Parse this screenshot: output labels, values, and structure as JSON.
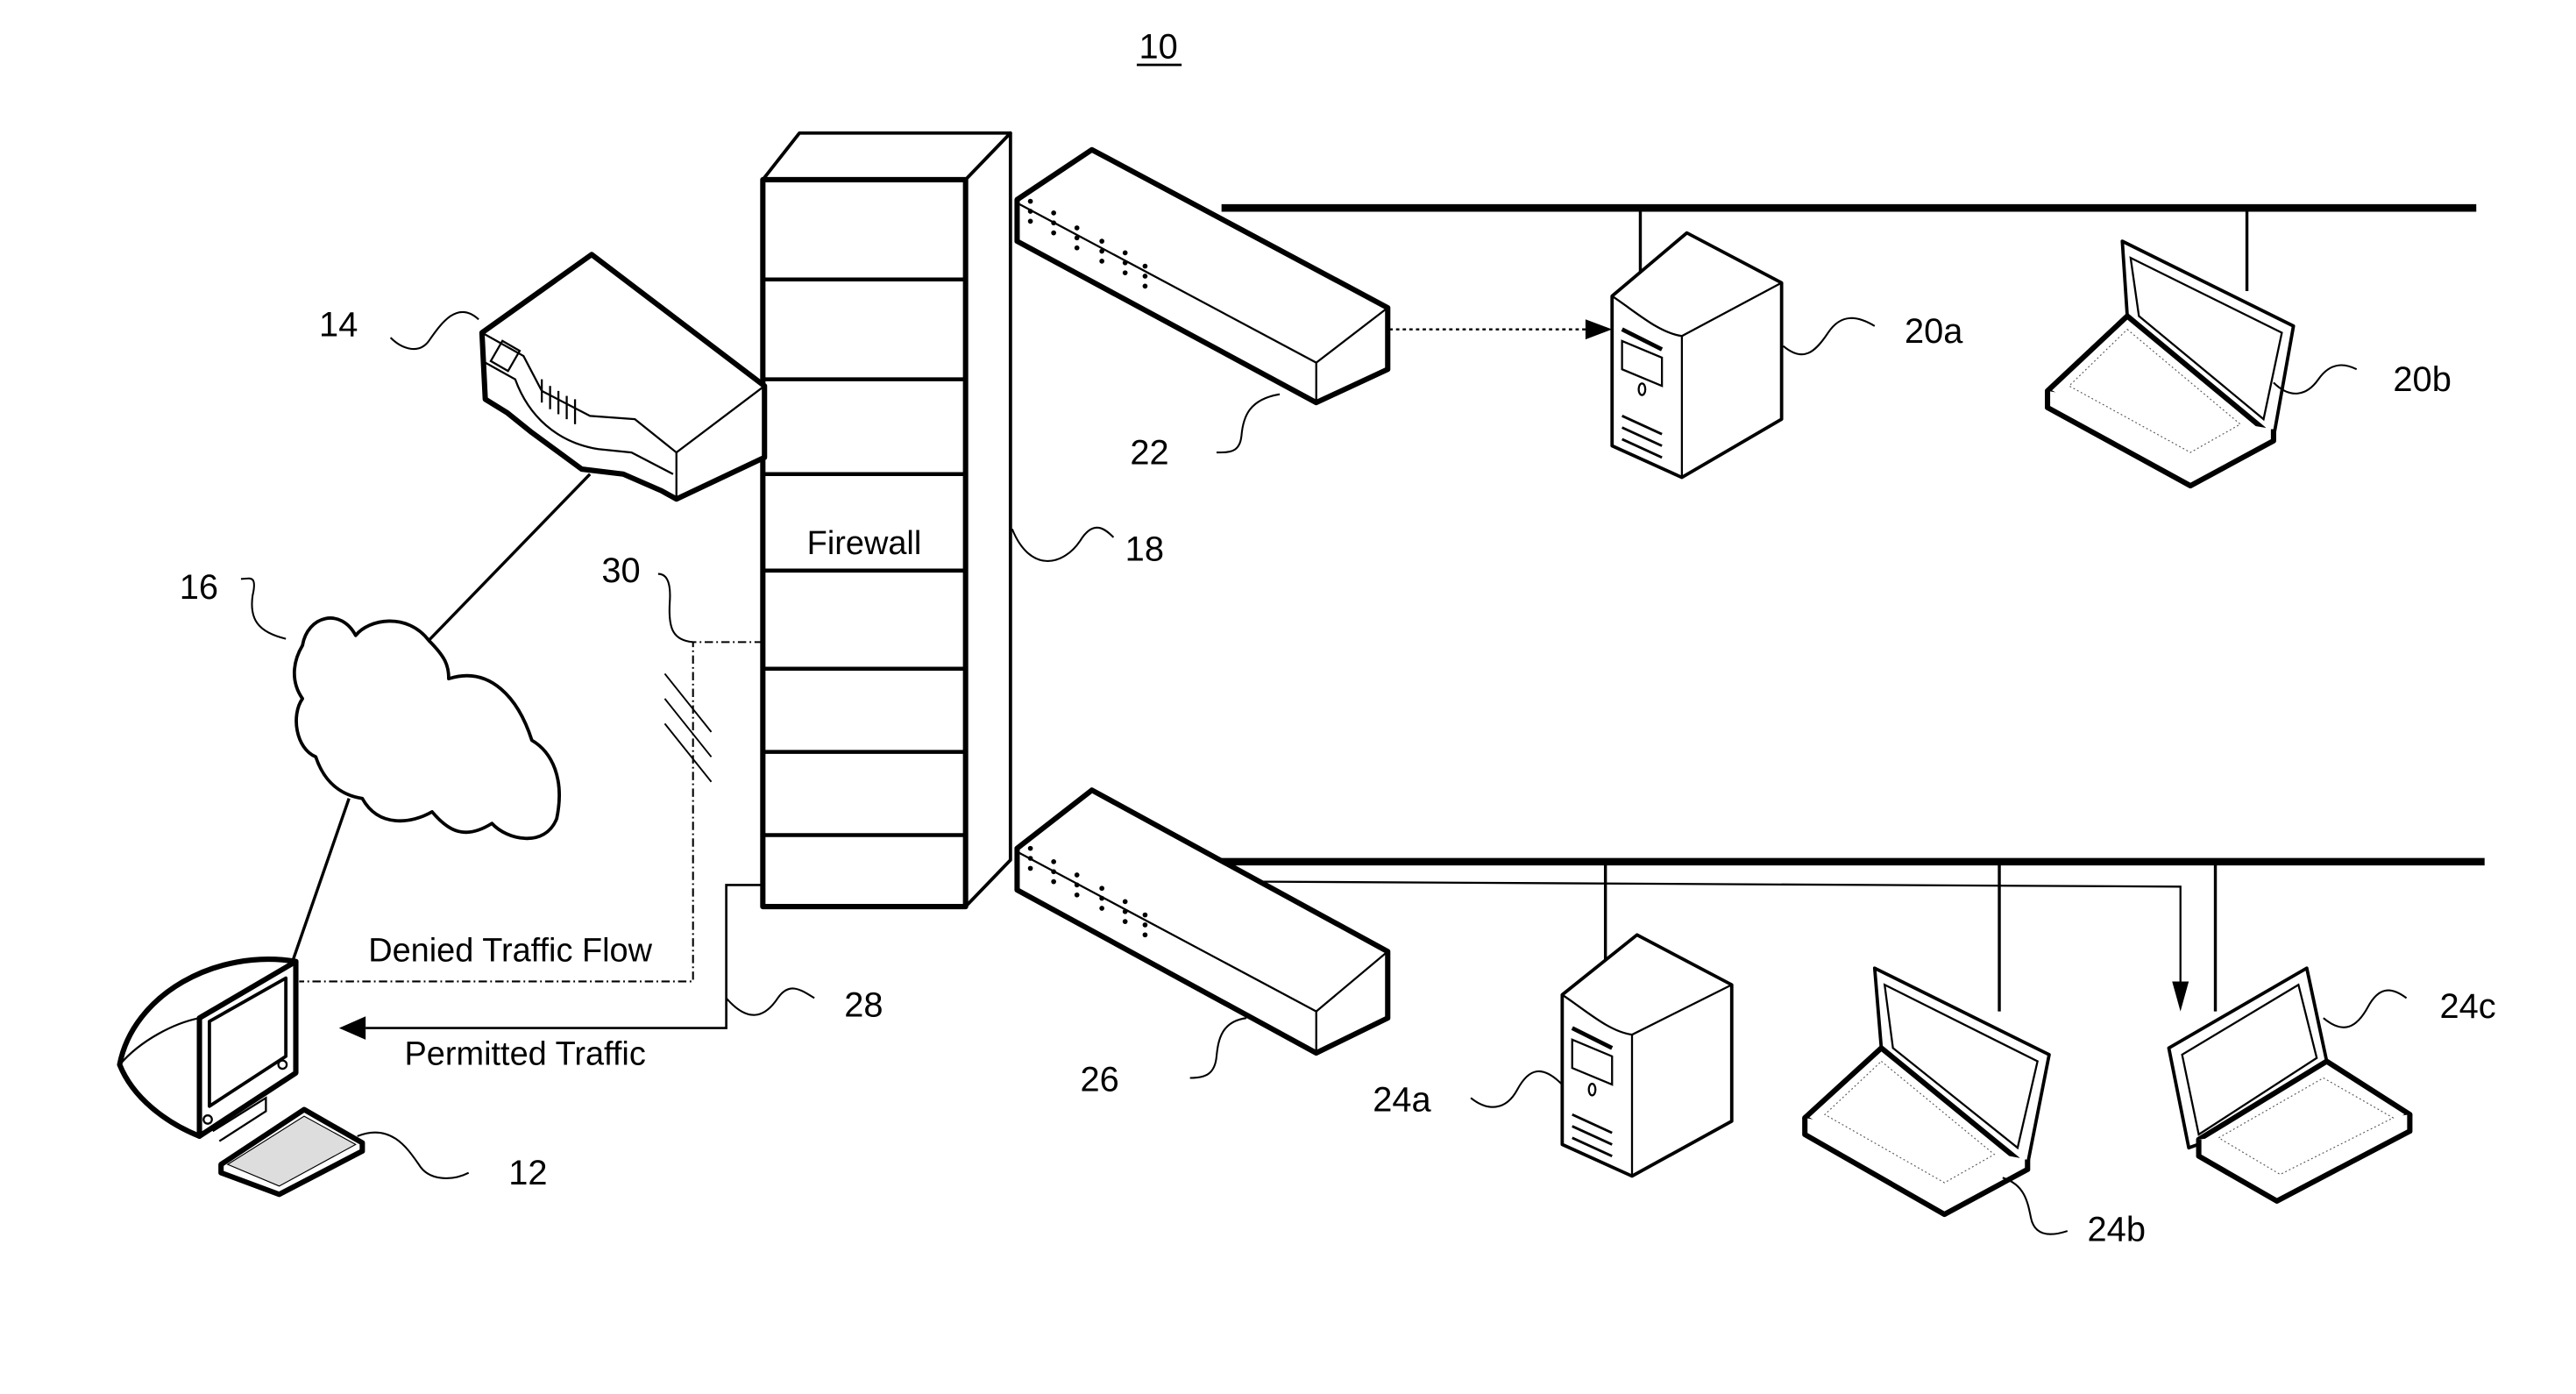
{
  "figure": {
    "figure_number": "10",
    "firewall_label": "Firewall",
    "denied_label": "Denied Traffic Flow",
    "permitted_label": "Permitted Traffic"
  },
  "components": {
    "client_computer": {
      "ref": "12",
      "type": "desktop-computer"
    },
    "router": {
      "ref": "14",
      "type": "router"
    },
    "network_cloud": {
      "ref": "16",
      "type": "internet-cloud"
    },
    "firewall": {
      "ref": "18",
      "type": "firewall-tower"
    },
    "server_upper": {
      "ref": "20a",
      "type": "server"
    },
    "laptop_upper": {
      "ref": "20b",
      "type": "laptop"
    },
    "switch_upper": {
      "ref": "22",
      "type": "network-switch"
    },
    "server_lower": {
      "ref": "24a",
      "type": "server"
    },
    "laptop_lower_1": {
      "ref": "24b",
      "type": "laptop"
    },
    "laptop_lower_2": {
      "ref": "24c",
      "type": "laptop"
    },
    "switch_lower": {
      "ref": "26",
      "type": "network-switch"
    },
    "permitted_path": {
      "ref": "28",
      "type": "traffic-path"
    },
    "denied_path": {
      "ref": "30",
      "type": "traffic-path"
    }
  }
}
